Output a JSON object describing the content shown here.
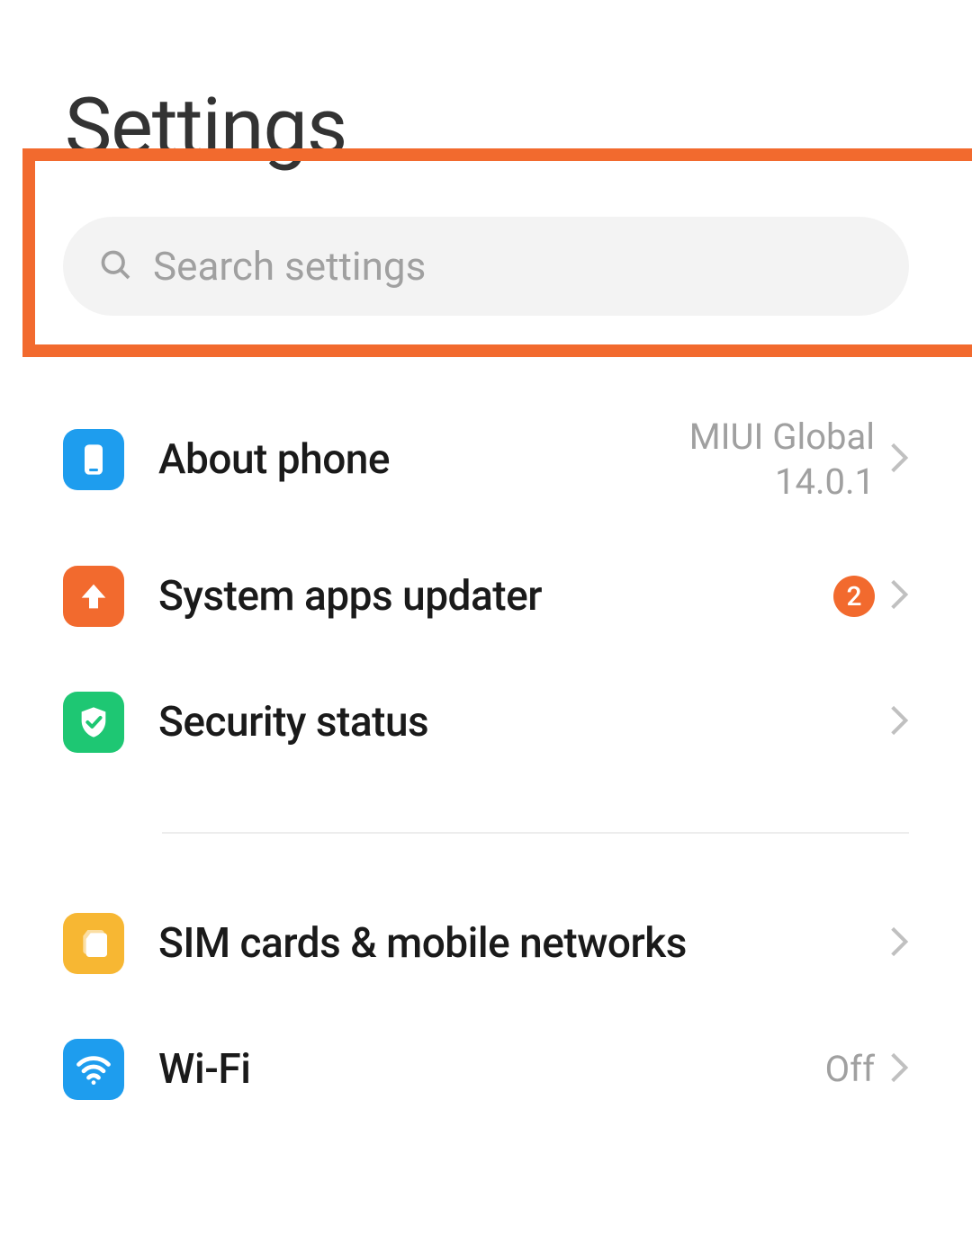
{
  "header": {
    "title": "Settings"
  },
  "search": {
    "placeholder": "Search settings"
  },
  "items": [
    {
      "icon": "phone-icon",
      "bg": "icon-about",
      "label": "About phone",
      "value": "MIUI Global\n14.0.1",
      "badge": null
    },
    {
      "icon": "arrow-up-icon",
      "bg": "icon-updater",
      "label": "System apps updater",
      "value": null,
      "badge": "2"
    },
    {
      "icon": "shield-check-icon",
      "bg": "icon-security",
      "label": "Security status",
      "value": null,
      "badge": null
    }
  ],
  "items2": [
    {
      "icon": "sim-icon",
      "bg": "icon-sim",
      "label": "SIM cards & mobile networks",
      "value": null,
      "badge": null
    },
    {
      "icon": "wifi-icon",
      "bg": "icon-wifi",
      "label": "Wi-Fi",
      "value": "Off",
      "badge": null
    }
  ]
}
